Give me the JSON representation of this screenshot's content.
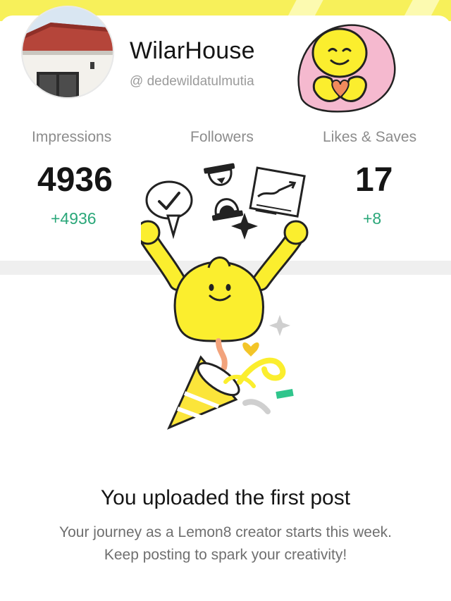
{
  "profile": {
    "username": "WilarHouse",
    "handle": "@ dedewildatulmutia"
  },
  "stats": [
    {
      "label": "Impressions",
      "value": "4936",
      "delta": "+4936"
    },
    {
      "label": "Followers",
      "value": "",
      "delta": ""
    },
    {
      "label": "Likes & Saves",
      "value": "17",
      "delta": "+8"
    }
  ],
  "message": {
    "title": "You uploaded the first post",
    "line1": "Your journey as a Lemon8 creator starts this week.",
    "line2": "Keep posting to spark your creativity!"
  },
  "colors": {
    "accent_yellow": "#f7f05a",
    "mascot_yellow": "#fbee2e",
    "positive_green": "#2aa779"
  },
  "icons": [
    "profile-avatar",
    "heart-hands-sticker",
    "celebration-mascot",
    "checkmark-bubble-icon",
    "hourglass-icon",
    "chart-paper-icon",
    "sparkle-icon",
    "party-horn-icon"
  ]
}
